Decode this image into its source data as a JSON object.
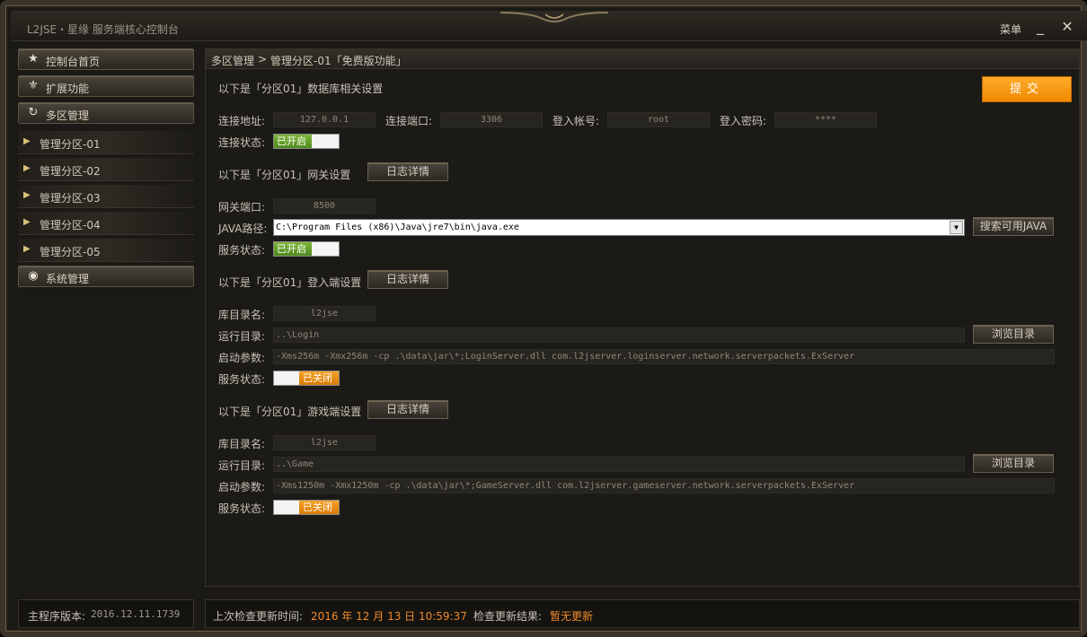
{
  "window": {
    "title": "L2JSE・星缘 服务端核心控制台",
    "menu_label": "菜单",
    "minimize": "_",
    "close": "✕"
  },
  "sidebar": {
    "home": {
      "label": "控制台首页",
      "icon": "star-icon"
    },
    "extensions": {
      "label": "扩展功能",
      "icon": "fleur-de-lis-icon"
    },
    "multi_zone": {
      "label": "多区管理",
      "icon": "refresh-icon"
    },
    "zones": [
      "管理分区-01",
      "管理分区-02",
      "管理分区-03",
      "管理分区-04",
      "管理分区-05"
    ],
    "system": {
      "label": "系统管理",
      "icon": "eye-icon"
    },
    "version_label": "主程序版本:",
    "version_value": "2016.12.11.1739"
  },
  "breadcrumb": {
    "root": "多区管理",
    "sep": ">",
    "current": "管理分区-01「免费版功能」"
  },
  "submit_label": "提交",
  "database": {
    "heading": "以下是「分区01」数据库相关设置",
    "address_label": "连接地址:",
    "address_value": "127.0.0.1",
    "port_label": "连接端口:",
    "port_value": "3306",
    "account_label": "登入帐号:",
    "account_value": "root",
    "password_label": "登入密码:",
    "password_value": "****",
    "status_label": "连接状态:",
    "status_on": "已开启"
  },
  "gateway": {
    "heading": "以下是「分区01」网关设置",
    "log_button": "日志详情",
    "port_label": "网关端口:",
    "port_value": "8500",
    "java_label": "JAVA路径:",
    "java_value": "C:\\Program Files (x86)\\Java\\jre7\\bin\\java.exe",
    "search_java_button": "搜索可用JAVA",
    "status_label": "服务状态:",
    "status_on": "已开启"
  },
  "login": {
    "heading": "以下是「分区01」登入端设置",
    "log_button": "日志详情",
    "dbname_label": "库目录名:",
    "dbname_value": "l2jse",
    "rundir_label": "运行目录:",
    "rundir_value": "..\\Login",
    "browse_button": "浏览目录",
    "args_label": "启动参数:",
    "args_value": "-Xms256m -Xmx256m -cp .\\data\\jar\\*;LoginServer.dll com.l2jserver.loginserver.network.serverpackets.ExServer",
    "status_label": "服务状态:",
    "status_off": "已关闭"
  },
  "game": {
    "heading": "以下是「分区01」游戏端设置",
    "log_button": "日志详情",
    "dbname_label": "库目录名:",
    "dbname_value": "l2jse",
    "rundir_label": "运行目录:",
    "rundir_value": "..\\Game",
    "browse_button": "浏览目录",
    "args_label": "启动参数:",
    "args_value": "-Xms1250m -Xmx1250m -cp .\\data\\jar\\*;GameServer.dll com.l2jserver.gameserver.network.serverpackets.ExServer",
    "status_label": "服务状态:",
    "status_off": "已关闭"
  },
  "status_bar": {
    "last_check_label": "上次检查更新时间:",
    "last_check_value": "2016 年 12 月 13 日 10:59:37",
    "result_label": "检查更新结果:",
    "result_value": "暂无更新"
  },
  "colors": {
    "accent_orange": "#f79a14",
    "status_green": "#5d9a26",
    "highlight_text": "#f08a2a"
  }
}
